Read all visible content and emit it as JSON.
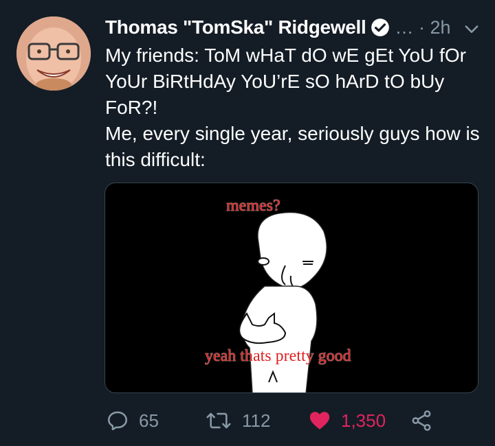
{
  "tweet": {
    "author_name": "Thomas \"TomSka\" Ridgewell",
    "timestamp": "… · 2h",
    "text_lines": [
      "My friends: ToM wHaT dO wE gEt YoU fOr YoUr BiRtHdAy YoU’rE sO hArD tO bUy FoR?!",
      "Me, every single year, seriously guys how is this difficult:"
    ],
    "media": {
      "top_caption": "memes?",
      "bottom_caption": "yeah thats pretty good"
    },
    "stats": {
      "replies": "65",
      "retweets": "112",
      "likes": "1,350"
    }
  },
  "icons": {
    "verified": "verified-badge-icon",
    "menu": "chevron-down-icon",
    "reply": "reply-icon",
    "retweet": "retweet-icon",
    "like": "heart-icon",
    "share": "share-icon"
  },
  "colors": {
    "background": "#141d26",
    "secondary_text": "#8899a6",
    "like_active": "#e0245e",
    "caption_red": "#e02020"
  }
}
